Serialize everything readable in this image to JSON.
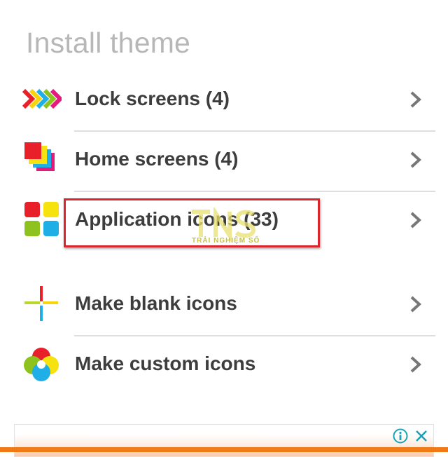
{
  "page": {
    "title": "Install theme"
  },
  "menu": [
    {
      "label": "Lock screens (4)",
      "icon": "arrows-icon"
    },
    {
      "label": "Home screens (4)",
      "icon": "stacked-squares-icon"
    },
    {
      "label": "Application icons (33)",
      "icon": "app-grid-icon"
    },
    {
      "label": "Make blank icons",
      "icon": "plus-cross-icon"
    },
    {
      "label": "Make custom icons",
      "icon": "color-wheel-icon"
    }
  ],
  "watermark": {
    "text": "TRẢI NGHIỆM SỐ",
    "logo": "TNS"
  },
  "ad": {
    "info_icon": "info-icon",
    "close_icon": "close-icon"
  },
  "colors": {
    "title": "#b7b7b7",
    "label": "#3d3d3d",
    "highlight": "#d8262e",
    "ad_bar": "#f07a16",
    "ad_icons": "#1aa3b8"
  }
}
